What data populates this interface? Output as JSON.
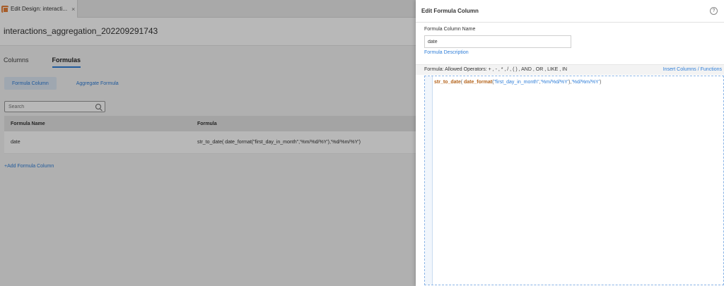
{
  "tab": {
    "label": "Edit Design: interacti...",
    "close": "×"
  },
  "design": {
    "title": "interactions_aggregation_202209291743"
  },
  "subtabs": [
    {
      "label": "Columns"
    },
    {
      "label": "Formulas"
    }
  ],
  "buttons": {
    "formula_column": "Formula Column",
    "aggregate_formula": "Aggregate Formula"
  },
  "search": {
    "placeholder": "Search"
  },
  "table": {
    "headers": {
      "name": "Formula Name",
      "formula": "Formula"
    },
    "rows": [
      {
        "name": "date",
        "formula": "str_to_date( date_format(\"first_day_in_month\",'%m/%d/%Y'),'%d/%m/%Y')"
      }
    ]
  },
  "add_link": "+Add Formula Column",
  "panel": {
    "title": "Edit Formula Column",
    "help": "?",
    "name_label": "Formula Column Name",
    "name_value": "date",
    "description_link": "Formula Description",
    "formula_label": "Formula: Allowed Operators: + , - , * , / , ( ) , AND , OR , LIKE , IN",
    "insert_link": "Insert Columns / Functions",
    "code": {
      "fn1": "str_to_date",
      "p1": "( ",
      "fn2": "date_format",
      "p2": "(",
      "s1": "\"first_day_in_month\"",
      "p3": ",",
      "s2": "'%m/%d/%Y'",
      "p4": "),",
      "s3": "'%d/%m/%Y'",
      "p5": ")"
    }
  },
  "colors": {
    "accent": "#2f7ed8",
    "function": "#b5651d",
    "tab_icon": "#e8823a"
  }
}
